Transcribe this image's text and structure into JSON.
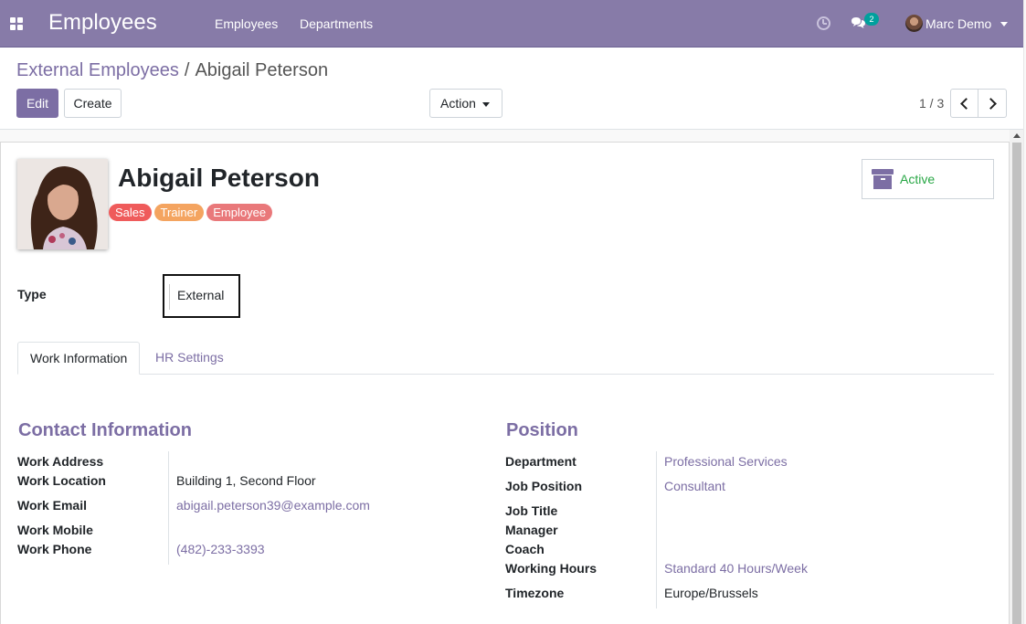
{
  "navbar": {
    "app_title": "Employees",
    "menu": [
      "Employees",
      "Departments"
    ],
    "chat_count": "2",
    "user_name": "Marc Demo"
  },
  "breadcrumb": {
    "parent": "External Employees",
    "separator": "/",
    "current": "Abigail Peterson"
  },
  "toolbar": {
    "edit_label": "Edit",
    "create_label": "Create",
    "action_label": "Action",
    "pager": "1 / 3"
  },
  "employee": {
    "name": "Abigail Peterson",
    "tags": [
      {
        "label": "Sales",
        "color": "#ef5b5b"
      },
      {
        "label": "Trainer",
        "color": "#f4a460"
      },
      {
        "label": "Employee",
        "color": "#e9787a"
      }
    ],
    "status_label": "Active",
    "type_label": "Type",
    "type_value": "External"
  },
  "tabs": [
    "Work Information",
    "HR Settings"
  ],
  "contact": {
    "title": "Contact Information",
    "work_address_label": "Work Address",
    "work_location_label": "Work Location",
    "work_location": "Building 1, Second Floor",
    "work_email_label": "Work Email",
    "work_email": "abigail.peterson39@example.com",
    "work_mobile_label": "Work Mobile",
    "work_phone_label": "Work Phone",
    "work_phone": "(482)-233-3393"
  },
  "position": {
    "title": "Position",
    "department_label": "Department",
    "department": "Professional Services",
    "job_position_label": "Job Position",
    "job_position": "Consultant",
    "job_title_label": "Job Title",
    "manager_label": "Manager",
    "coach_label": "Coach",
    "working_hours_label": "Working Hours",
    "working_hours": "Standard 40 Hours/Week",
    "timezone_label": "Timezone",
    "timezone": "Europe/Brussels"
  },
  "colors": {
    "brand": "#877ba8",
    "accent": "#7c6ea4",
    "active_green": "#28a745",
    "badge_teal": "#00a09d"
  }
}
